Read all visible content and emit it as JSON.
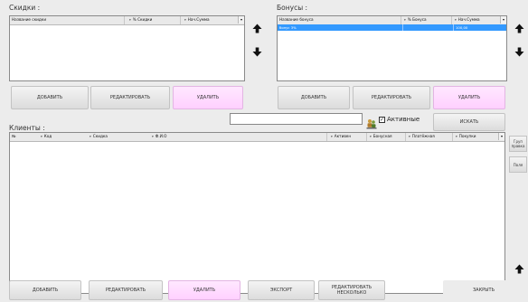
{
  "discounts": {
    "title": "Скидки :",
    "columns": [
      "Название скидки",
      "% Скидки",
      "Нач.Сумма"
    ],
    "rows": [],
    "buttons": {
      "add": "ДОБАВИТЬ",
      "edit": "РЕДАКТИРОВАТЬ",
      "delete": "УДАЛИТЬ"
    }
  },
  "bonuses": {
    "title": "Бонусы :",
    "columns": [
      "Название бонуса",
      "% Бонуса",
      "Нач.Сумма"
    ],
    "rows": [
      {
        "name": "бонус 3%",
        "percent": "",
        "start_sum": "100,00"
      }
    ],
    "buttons": {
      "add": "ДОБАВИТЬ",
      "edit": "РЕДАКТИРОВАТЬ",
      "delete": "УДАЛИТЬ"
    }
  },
  "clients": {
    "title": "Клиенты :",
    "search_value": "",
    "active_label": "Активные",
    "active_checked": true,
    "search_button": "ИСКАТЬ",
    "columns_left": [
      "№",
      "Код",
      "Скидка",
      "Ф.И.О"
    ],
    "columns_right": [
      "Активен",
      "Бонусная",
      "Платёжная",
      "Покупки"
    ],
    "rows": [],
    "side_buttons": {
      "group": "Груп правка",
      "fields": "Поля"
    }
  },
  "bottom_buttons": {
    "add": "ДОБАВИТЬ",
    "edit": "РЕДАКТИРОВАТЬ",
    "delete": "УДАЛИТЬ",
    "export": "ЭКСПОРТ",
    "edit_multiple_1": "РЕДАКТИРОВАТЬ",
    "edit_multiple_2": "НЕСКОЛЬКО",
    "close": "ЗАКРЫТЬ"
  },
  "icons": {
    "up": "arrow-up-icon",
    "down": "arrow-down-icon",
    "search": "people-search-icon",
    "dropdown": "chevron-down-icon"
  },
  "colors": {
    "selection": "#3399ff",
    "delete_button": "#ffd6ff",
    "panel_border": "#8a8a8a"
  }
}
